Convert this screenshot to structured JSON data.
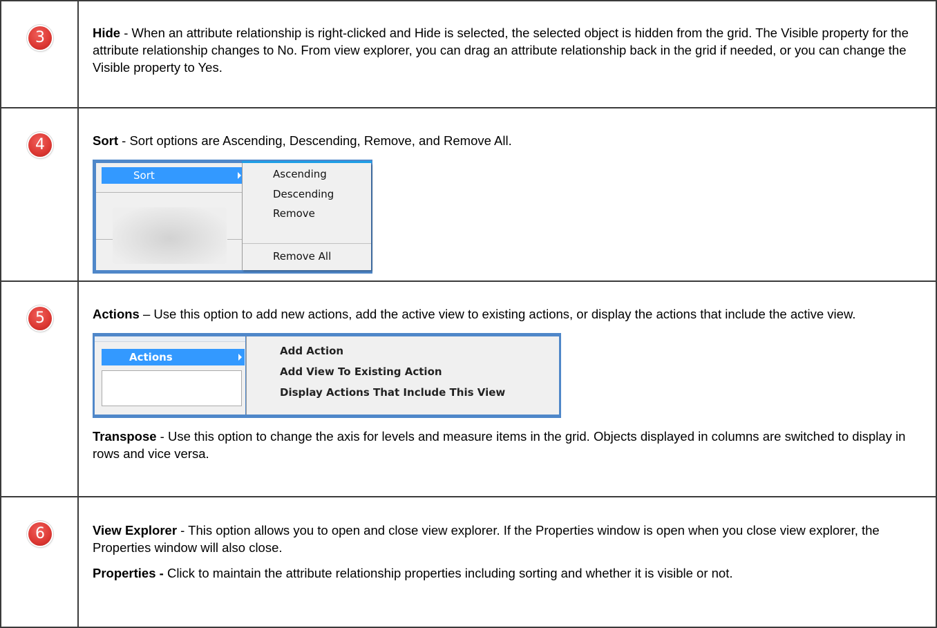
{
  "rows": [
    {
      "number": "3",
      "term": "Hide",
      "sep": " - ",
      "text": "When an attribute relationship is right-clicked and Hide is selected, the selected object is hidden from the grid. The Visible property for the attribute relationship changes to No. From view explorer, you can drag an attribute relationship back in the grid if needed, or you can change the Visible property to Yes."
    },
    {
      "number": "4",
      "term": "Sort",
      "sep": " - ",
      "text": "Sort options are Ascending, Descending, Remove, and Remove All.",
      "menu": {
        "selected": "Sort",
        "submenu": [
          "Ascending",
          "Descending",
          "Remove",
          "Remove All"
        ]
      }
    },
    {
      "number": "5",
      "term": "Actions",
      "sep": " – ",
      "text": "Use this option to add new actions, add the active view to existing actions, or display the actions that include the active view.",
      "menu": {
        "selected": "Actions",
        "submenu": [
          "Add Action",
          "Add View To Existing Action",
          "Display Actions That Include This View"
        ]
      },
      "term2": "Transpose",
      "sep2": " - ",
      "text2": "Use this option to change the axis for levels and measure items in the grid. Objects displayed in columns are switched to display in rows and vice versa."
    },
    {
      "number": "6",
      "term": "View Explorer",
      "sep": " - ",
      "text": "This option allows you to open and close view explorer. If the Properties window is open when you close view explorer, the Properties window will also close.",
      "term2": "Properties -",
      "sep2": " ",
      "text2": "Click to maintain the attribute relationship properties including sorting and whether it is visible or not."
    }
  ],
  "colors": {
    "badge": "#dc3833",
    "menu_highlight": "#3399ff",
    "menu_border": "#4f87c9"
  }
}
